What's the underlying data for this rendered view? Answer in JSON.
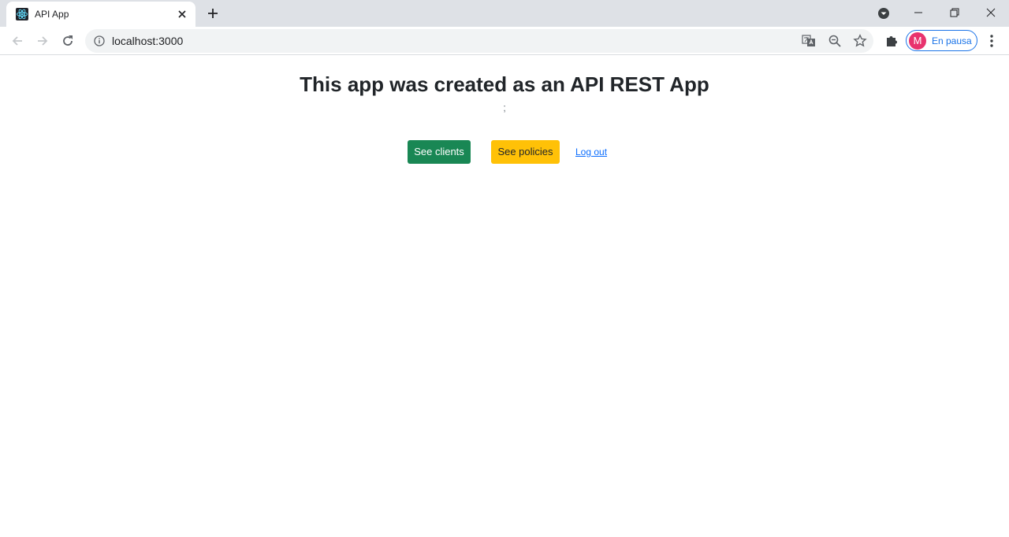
{
  "browser": {
    "tab": {
      "title": "API App",
      "favicon": "react-logo-icon"
    },
    "address": {
      "url": "localhost:3000"
    },
    "profile": {
      "initial": "M",
      "status": "En pausa"
    }
  },
  "page": {
    "title": "This app was created as an API REST App",
    "subtext": ";",
    "buttons": {
      "see_clients": "See clients",
      "see_policies": "See policies"
    },
    "logout_link": "Log out"
  },
  "colors": {
    "success": "#198754",
    "warning": "#ffc107",
    "link": "#0d6efd",
    "accent": "#1a73e8",
    "avatar": "#e8336e"
  }
}
